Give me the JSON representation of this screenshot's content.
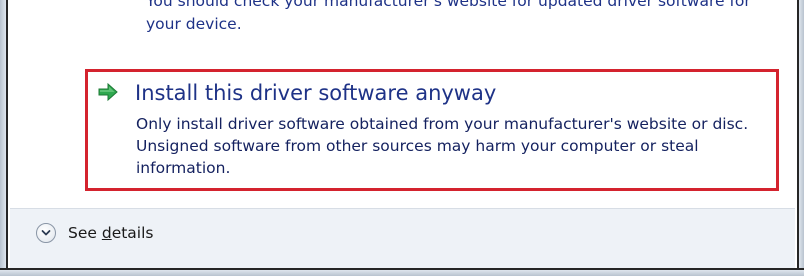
{
  "warning_text": "You should check your manufacturer's website for updated driver software for your device.",
  "option": {
    "icon": "green-arrow-icon",
    "title": "Install this driver software anyway",
    "description": "Only install driver software obtained from your manufacturer's website or disc. Unsigned software from other sources may harm your computer or steal information.",
    "highlight_color": "#d4232e"
  },
  "footer": {
    "details_icon": "chevron-down-icon",
    "details_prefix": "See ",
    "details_underlined": "d",
    "details_suffix": "etails"
  },
  "colors": {
    "link_blue": "#1e3287",
    "arrow_green": "#2fa84f",
    "footer_bg": "#eef2f7"
  }
}
